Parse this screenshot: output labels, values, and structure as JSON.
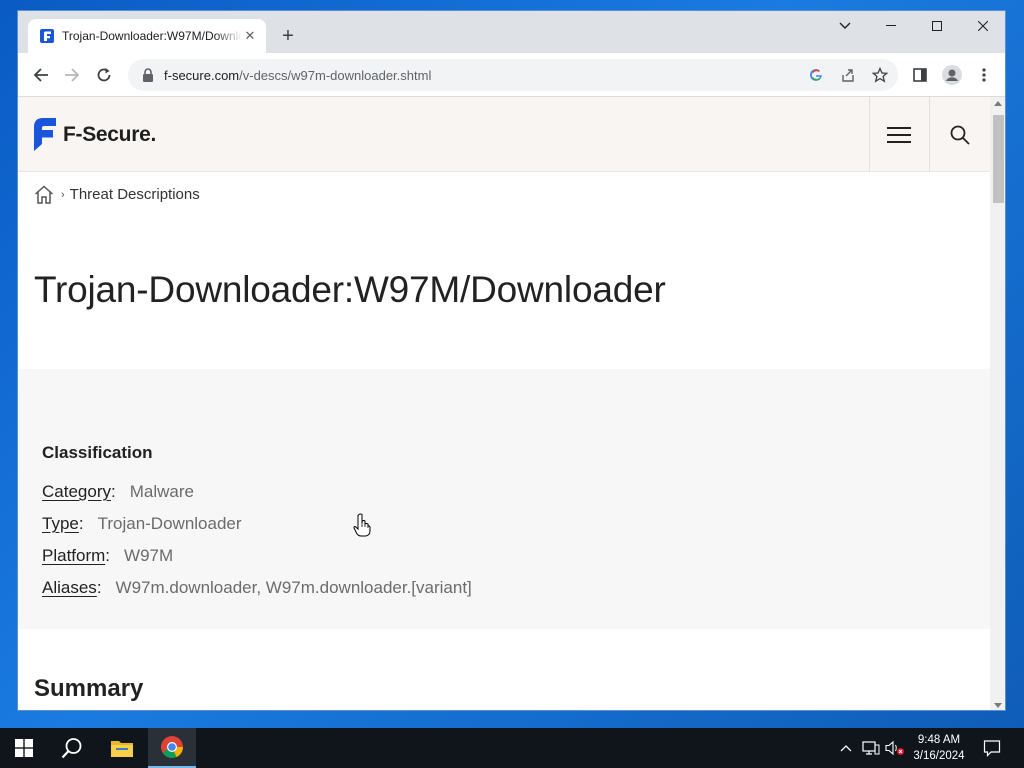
{
  "browser": {
    "tab_title": "Trojan-Downloader:W97M/Downloader",
    "url_domain": "f-secure.com",
    "url_path": "/v-descs/w97m-downloader.shtml"
  },
  "site": {
    "logo_text": "F-Secure.",
    "brand_color": "#1a56db"
  },
  "breadcrumb": {
    "item": "Threat Descriptions"
  },
  "page": {
    "title": "Trojan-Downloader:W97M/Downloader"
  },
  "classification": {
    "heading": "Classification",
    "rows": [
      {
        "label": "Category",
        "colon": ":",
        "value": "Malware"
      },
      {
        "label": "Type",
        "colon": ":",
        "value": "Trojan-Downloader"
      },
      {
        "label": "Platform",
        "colon": ":",
        "value": "W97M"
      },
      {
        "label": "Aliases",
        "colon": ":",
        "value": "W97m.downloader, W97m.downloader.[variant]"
      }
    ]
  },
  "summary": {
    "heading": "Summary"
  },
  "taskbar": {
    "time": "9:48 AM",
    "date": "3/16/2024"
  }
}
